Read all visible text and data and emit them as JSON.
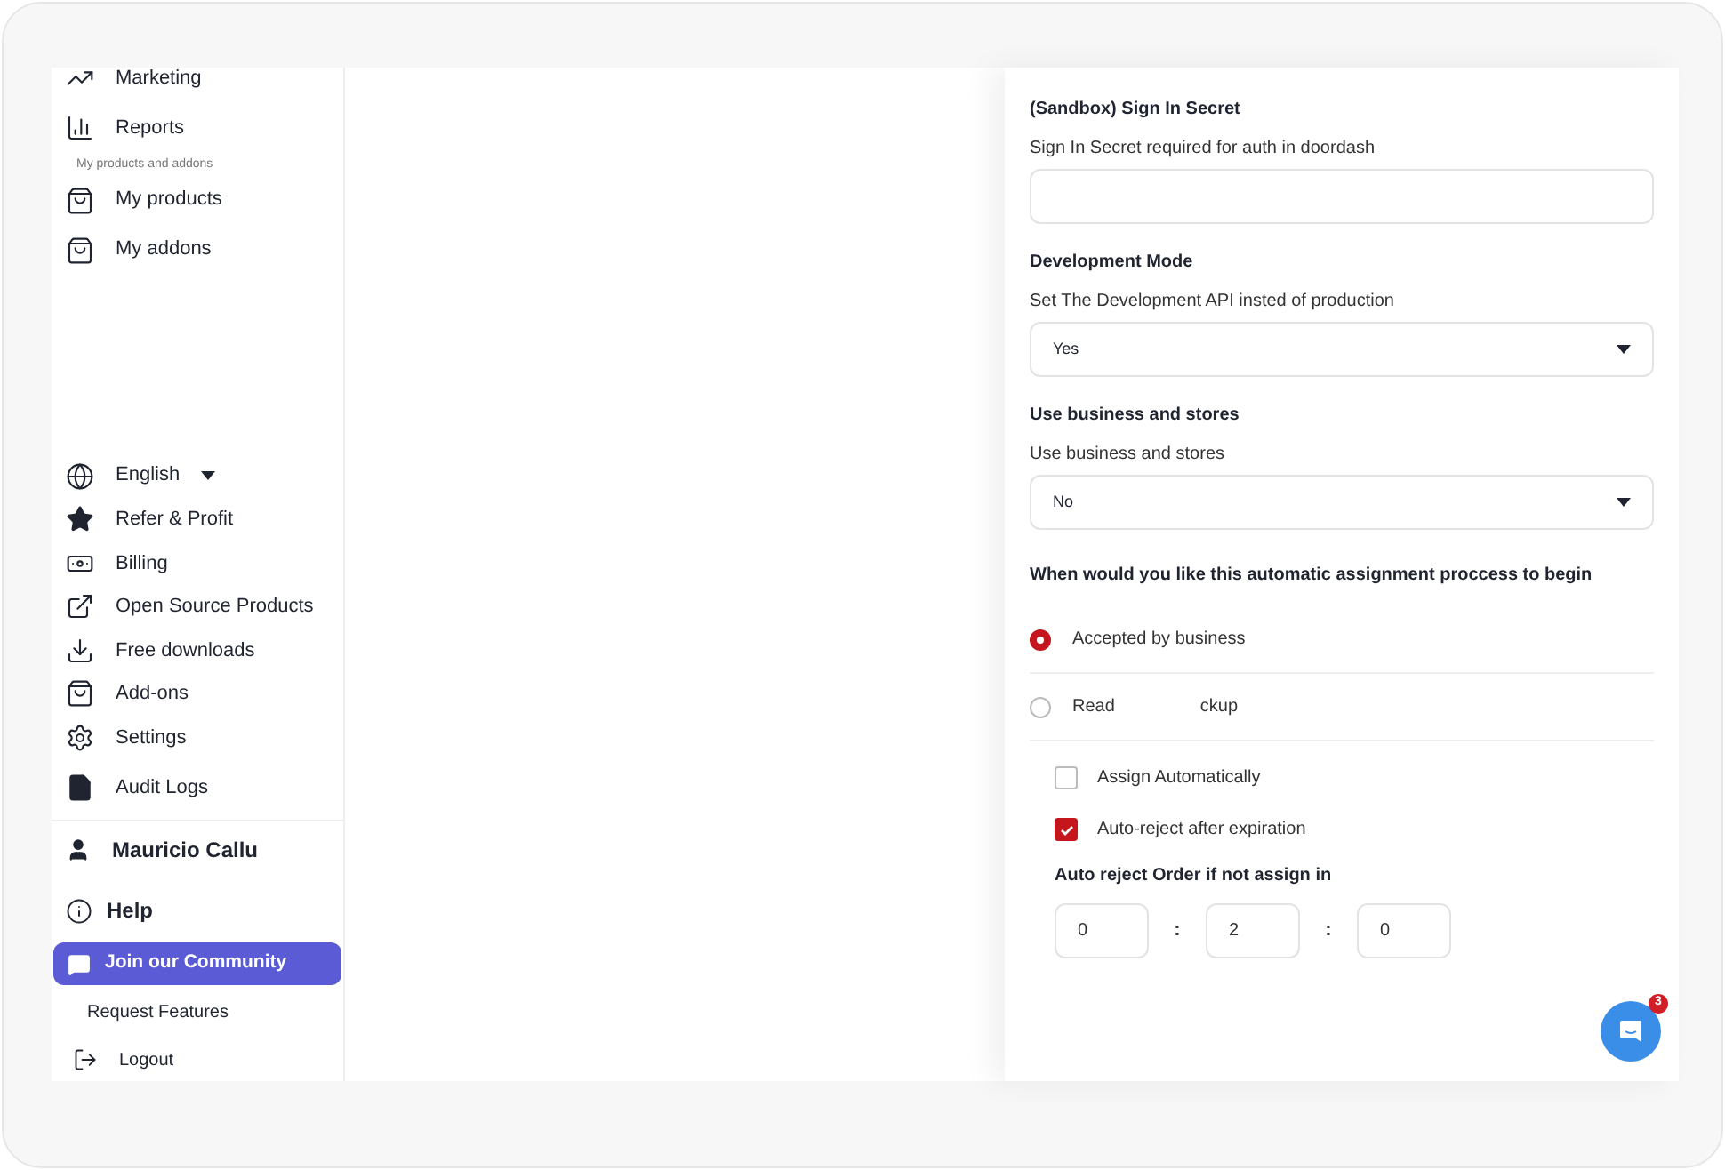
{
  "sidebar": {
    "top_items": [
      {
        "label": "Marketing"
      },
      {
        "label": "Reports"
      }
    ],
    "section_label": "My products and addons",
    "product_items": [
      {
        "label": "My products"
      },
      {
        "label": "My addons"
      }
    ],
    "language": {
      "label": "English"
    },
    "bottom_items": [
      {
        "label": "Refer & Profit"
      },
      {
        "label": "Billing"
      },
      {
        "label": "Open Source Products"
      },
      {
        "label": "Free downloads"
      },
      {
        "label": "Add-ons"
      },
      {
        "label": "Settings"
      },
      {
        "label": "Audit Logs"
      }
    ],
    "user": {
      "name": "Mauricio Callu"
    },
    "help": {
      "label": "Help"
    },
    "community_button": {
      "label": "Join our Community"
    },
    "request_features": {
      "label": "Request Features"
    },
    "logout": {
      "label": "Logout"
    }
  },
  "form": {
    "fields": [
      {
        "kind": "input",
        "title": "(Sandbox) Sign In Secret",
        "description": "Sign In Secret required for auth in doordash"
      },
      {
        "kind": "select",
        "title": "Development Mode",
        "description": "Set The Development API insted of production",
        "value": "Yes"
      },
      {
        "kind": "select",
        "title": "Use business and stores",
        "description": "Use business and stores",
        "value": "No"
      }
    ],
    "question": "When would you like this automatic assignment proccess to begin",
    "radios": [
      {
        "label": "Accepted by business",
        "selected": true
      },
      {
        "label": "Read",
        "label_tail": "ckup",
        "selected": false
      }
    ],
    "checkboxes": [
      {
        "label": "Assign Automatically",
        "checked": false
      },
      {
        "label": "Auto-reject after expiration",
        "checked": true
      }
    ],
    "timer_title": "Auto reject Order if not assign in",
    "timer_values": [
      "0",
      "2",
      "0"
    ],
    "separator": ":"
  },
  "chat": {
    "badge": "3"
  }
}
